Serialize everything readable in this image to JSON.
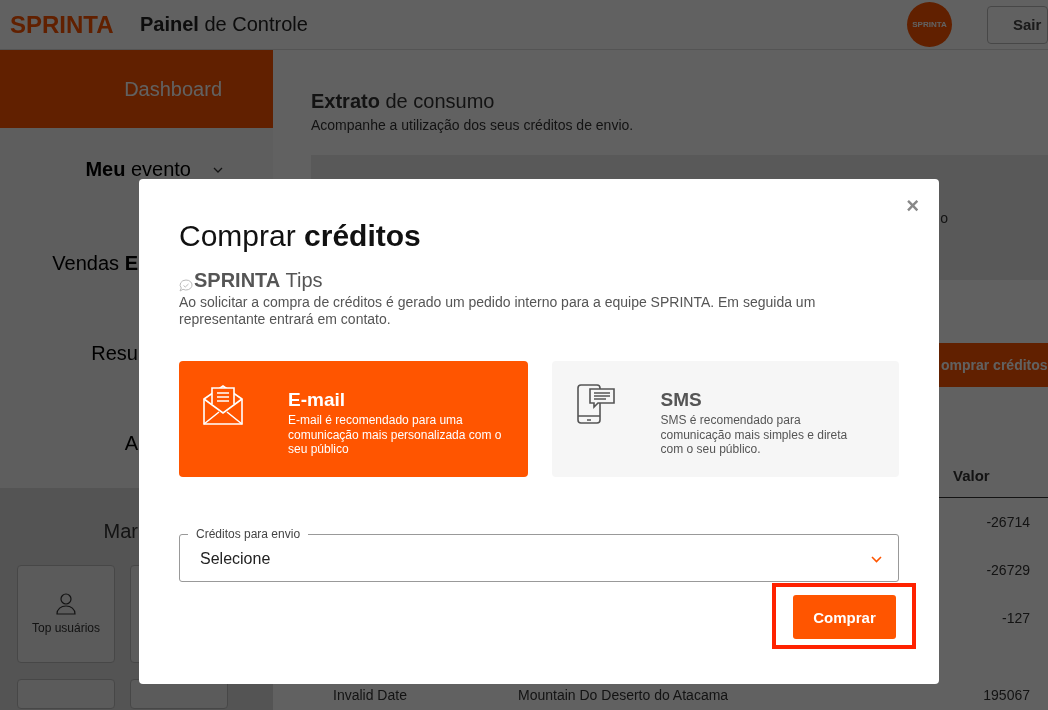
{
  "header": {
    "logo": "SPRINTA",
    "title": "**Painel** de Controle",
    "avatar": "SPRINTA",
    "logout": "Sair"
  },
  "sidebar": {
    "items": [
      {
        "label": "Dashboard",
        "selected": true
      },
      {
        "label": "**Meu** evento",
        "selected": false,
        "expandable": true
      },
      {
        "label": "Vendas **E**",
        "selected": false
      },
      {
        "label": "Resu",
        "selected": false
      },
      {
        "label": "A",
        "selected": false
      }
    ],
    "section": {
      "title": "Mar",
      "tiles": [
        {
          "label": "Top usuários",
          "kind": "user"
        },
        {
          "kind": "blank"
        }
      ]
    }
  },
  "main": {
    "title": "**Extrato** de consumo",
    "subtitle": "Acompanhe a utilização dos seus créditos de envio.",
    "card_text": "o",
    "buy_button": "omprar créditos",
    "table": {
      "columns": [
        "Valor"
      ],
      "rows": [
        {
          "column_3": "-26714"
        },
        {
          "column_3": "-26729"
        },
        {
          "column_3": "-127"
        },
        {
          "column_1": "Invalid Date",
          "column_2": "Mountain Do Deserto do Atacama",
          "column_3": "195067"
        }
      ]
    }
  },
  "modal": {
    "title": "Comprar **créditos**",
    "close": "×",
    "tips_title": "**SPRINTA** Tips",
    "tips_text": "Ao solicitar a compra de créditos é gerado um pedido interno para a equipe SPRINTA. Em seguida um representante entrará em contato.",
    "options": [
      {
        "kind": "email",
        "title": "E-mail",
        "text": "E-mail é recomendado para uma comunicação mais personalizada com o seu público",
        "selected": true
      },
      {
        "kind": "sms",
        "title": "SMS",
        "text": "SMS é recomendado para comunicação mais simples e direta com o seu público.",
        "selected": false
      }
    ],
    "select": {
      "label": "Créditos para envio",
      "value": "Selecione"
    },
    "submit": "Comprar",
    "submit_highlighted": true
  }
}
